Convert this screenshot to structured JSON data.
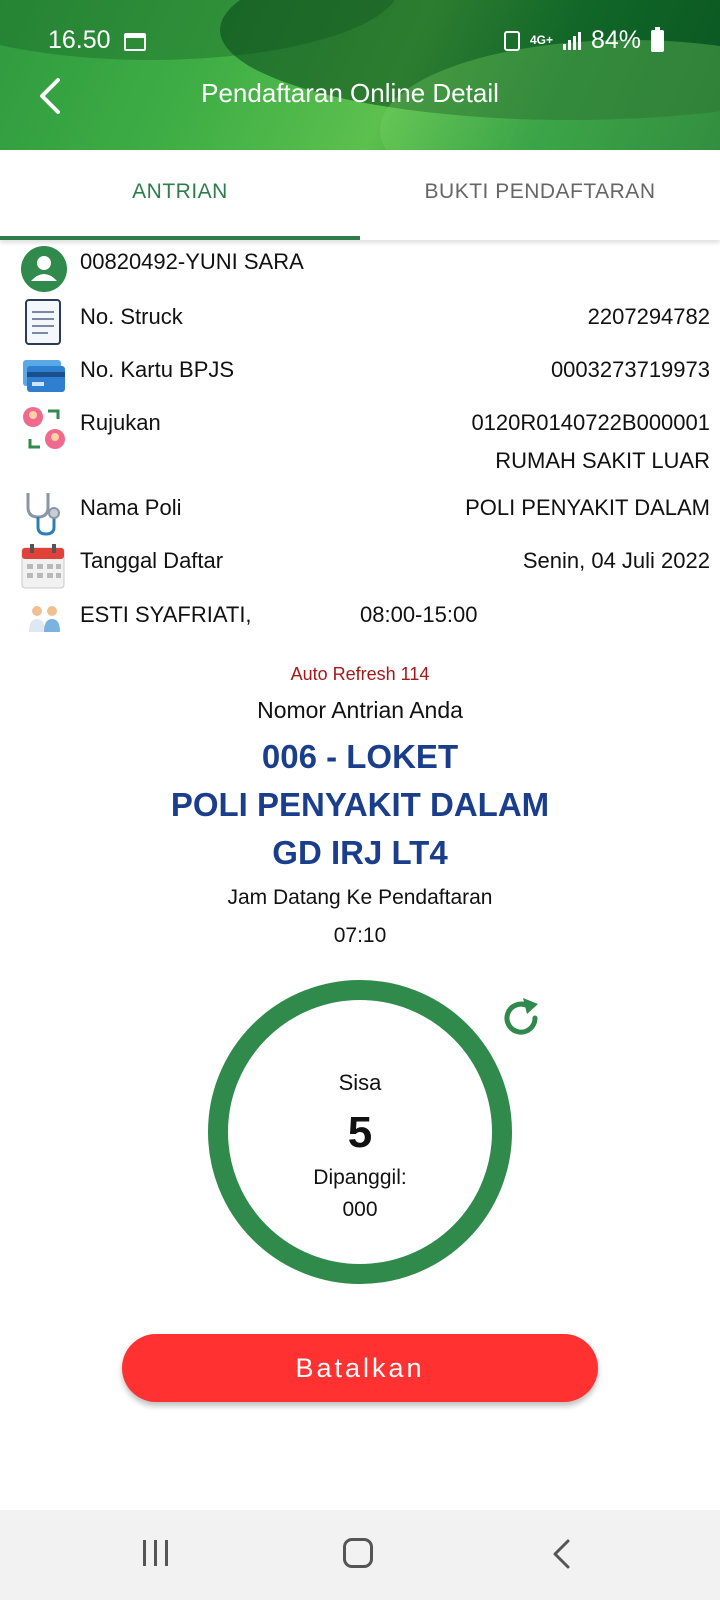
{
  "status_bar": {
    "time": "16.50",
    "network": "4G+",
    "battery": "84%"
  },
  "header": {
    "title": "Pendaftaran Online Detail"
  },
  "tabs": [
    {
      "label": "ANTRIAN",
      "active": true
    },
    {
      "label": "BUKTI PENDAFTARAN",
      "active": false
    }
  ],
  "info": {
    "patient": "00820492-YUNI SARA",
    "struk_label": "No. Struck",
    "struk_value": "2207294782",
    "bpjs_label": "No. Kartu BPJS",
    "bpjs_value": "0003273719973",
    "rujukan_label": "Rujukan",
    "rujukan_value": "0120R0140722B000001",
    "rujukan_sub": "RUMAH SAKIT LUAR",
    "poli_label": "Nama Poli",
    "poli_value": "POLI PENYAKIT DALAM",
    "tanggal_label": "Tanggal Daftar",
    "tanggal_value": "Senin, 04 Juli 2022",
    "doctor": "ESTI SYAFRIATI,",
    "doctor_hours": "08:00-15:00"
  },
  "queue": {
    "auto_refresh": "Auto Refresh 114",
    "title": "Nomor Antrian Anda",
    "line1": "006 - LOKET",
    "line2": "POLI PENYAKIT DALAM",
    "line3": "GD IRJ LT4",
    "jam_label": "Jam Datang Ke Pendaftaran",
    "jam_value": "07:10",
    "sisa_label": "Sisa",
    "sisa_value": "5",
    "dipanggil_label": "Dipanggil:",
    "dipanggil_value": "000"
  },
  "actions": {
    "cancel_label": "Batalkan"
  },
  "colors": {
    "header_green": "#3fae45",
    "tab_active": "#2e7d4a",
    "queue_blue": "#1a3e8c",
    "circle_green": "#2f8a4b",
    "cancel_red": "#ff3131",
    "auto_refresh_red": "#a0191b"
  },
  "icons": {
    "back": "back-arrow-icon",
    "person": "person-icon",
    "receipt": "receipt-icon",
    "card": "card-icon",
    "referral": "referral-icon",
    "stethoscope": "stethoscope-icon",
    "calendar": "calendar-icon",
    "doctors": "doctors-icon",
    "refresh": "refresh-icon"
  }
}
